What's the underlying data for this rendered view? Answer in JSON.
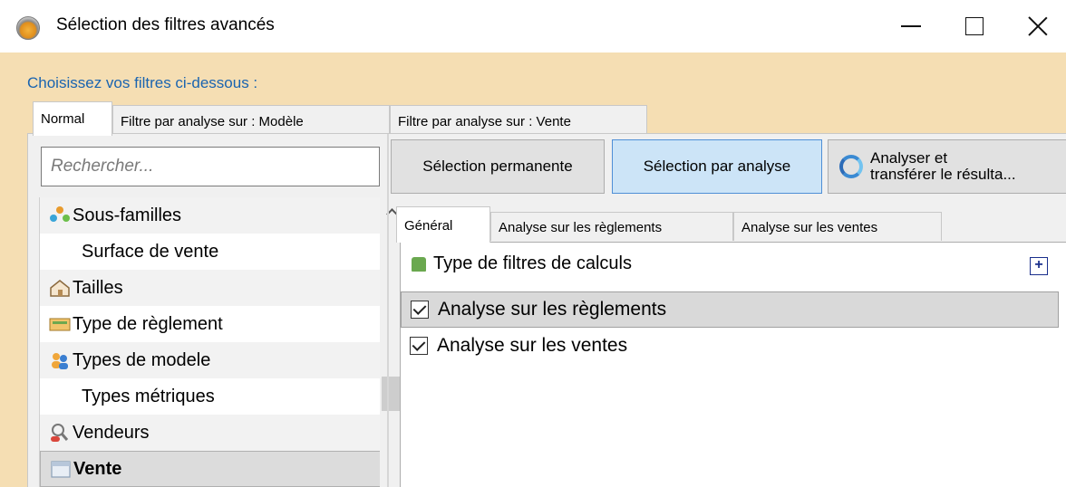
{
  "window": {
    "title": "Sélection des filtres avancés",
    "icon": "app-logo-icon"
  },
  "instruction": "Choisissez vos filtres ci-dessous :",
  "outer_tabs": [
    {
      "label": "Normal",
      "active": true
    },
    {
      "label": "Filtre par analyse sur : Modèle",
      "active": false
    },
    {
      "label": "Filtre par analyse sur : Vente",
      "active": false
    }
  ],
  "search": {
    "placeholder": "Rechercher..."
  },
  "filter_list": [
    {
      "label": "Sous-familles",
      "icon": "people-icon"
    },
    {
      "label": "Surface de vente",
      "icon": ""
    },
    {
      "label": "Tailles",
      "icon": "house-icon"
    },
    {
      "label": "Type de règlement",
      "icon": "payment-icon"
    },
    {
      "label": "Types de modele",
      "icon": "users-icon"
    },
    {
      "label": "Types métriques",
      "icon": ""
    },
    {
      "label": "Vendeurs",
      "icon": "seller-icon"
    },
    {
      "label": "Vente",
      "icon": "calendar-icon",
      "selected": true
    }
  ],
  "right_buttons": {
    "permanent": "Sélection permanente",
    "by_analysis": "Sélection par analyse",
    "analyze_line1": "Analyser et",
    "analyze_line2": "transférer le résulta..."
  },
  "inner_tabs": [
    {
      "label": "Général",
      "active": true
    },
    {
      "label": "Analyse sur les règlements",
      "active": false
    },
    {
      "label": "Analyse sur les ventes",
      "active": false
    }
  ],
  "group": {
    "title": "Type de filtres de calculs",
    "expand_symbol": "+"
  },
  "checks": [
    {
      "label": "Analyse sur les règlements",
      "checked": true,
      "highlighted": true
    },
    {
      "label": "Analyse sur les ventes",
      "checked": true,
      "highlighted": false
    }
  ],
  "colors": {
    "background": "#f5deb3",
    "link_blue": "#1a64b0",
    "active_button": "#cce4f7"
  }
}
